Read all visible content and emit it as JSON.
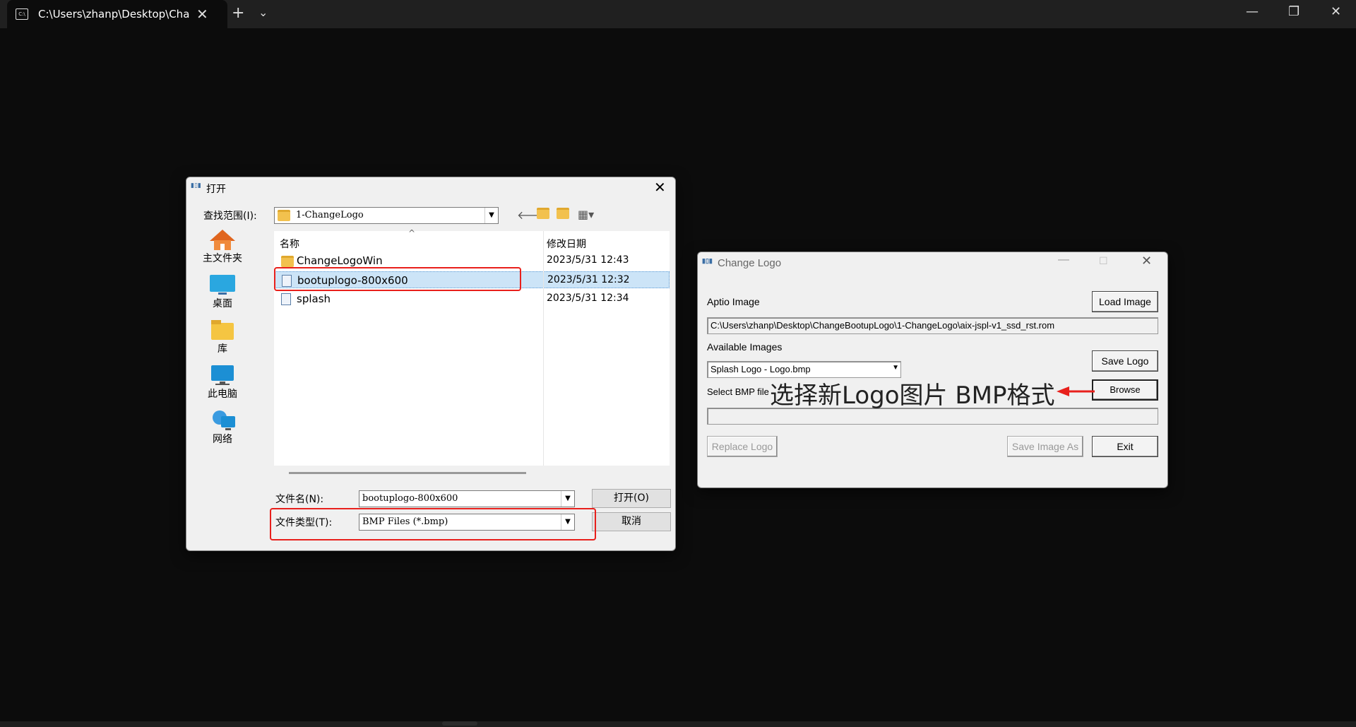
{
  "terminal": {
    "tab_title": "C:\\Users\\zhanp\\Desktop\\Cha",
    "tab_icon": "C:\\",
    "colors": {
      "background": "#0c0c0c",
      "titlebar": "#202020"
    }
  },
  "open_dialog": {
    "title": "打开",
    "look_in_label": "查找范围(I):",
    "look_in_value": "1-ChangeLogo",
    "places": [
      {
        "label": "主文件夹",
        "icon": "home-icon"
      },
      {
        "label": "桌面",
        "icon": "desktop-icon"
      },
      {
        "label": "库",
        "icon": "library-icon"
      },
      {
        "label": "此电脑",
        "icon": "computer-icon"
      },
      {
        "label": "网络",
        "icon": "network-icon"
      }
    ],
    "columns": {
      "name": "名称",
      "date": "修改日期"
    },
    "files": [
      {
        "name": "ChangeLogoWin",
        "date": "2023/5/31 12:43",
        "type": "folder"
      },
      {
        "name": "bootuplogo-800x600",
        "date": "2023/5/31 12:32",
        "type": "file",
        "selected": true
      },
      {
        "name": "splash",
        "date": "2023/5/31 12:34",
        "type": "file"
      }
    ],
    "filename_label": "文件名(N):",
    "filename_value": "bootuplogo-800x600",
    "filetype_label": "文件类型(T):",
    "filetype_value": "BMP Files (*.bmp)",
    "open_button": "打开(O)",
    "cancel_button": "取消"
  },
  "change_logo": {
    "title": "Change Logo",
    "aptio_label": "Aptio Image",
    "load_image_button": "Load Image",
    "aptio_path": "C:\\Users\\zhanp\\Desktop\\ChangeBootupLogo\\1-ChangeLogo\\aix-jspl-v1_ssd_rst.rom",
    "available_label": "Available Images",
    "available_value": "Splash Logo - Logo.bmp",
    "save_logo_button": "Save Logo",
    "select_bmp_label": "Select BMP file",
    "browse_button": "Browse",
    "bmp_path": "",
    "replace_logo_button": "Replace Logo",
    "save_image_as_button": "Save Image As",
    "exit_button": "Exit"
  },
  "annotation": {
    "text": "选择新Logo图片 BMP格式",
    "color": "#e8201c"
  }
}
